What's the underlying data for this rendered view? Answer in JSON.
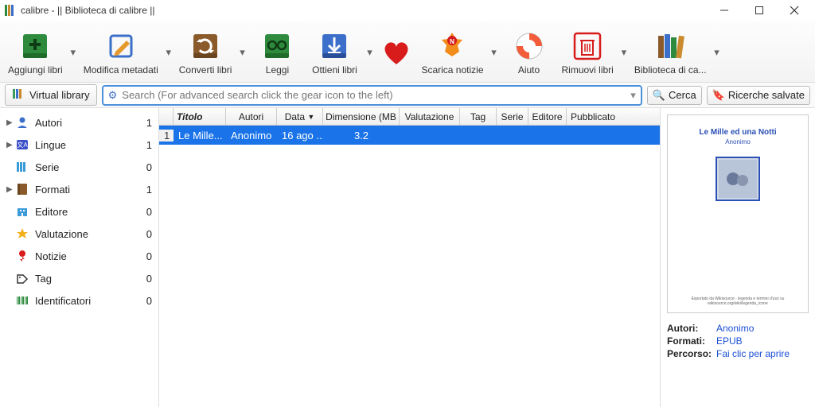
{
  "window": {
    "title": "calibre - || Biblioteca di calibre ||"
  },
  "toolbar": {
    "add": "Aggiungi libri",
    "edit": "Modifica metadati",
    "convert": "Converti libri",
    "read": "Leggi",
    "get": "Ottieni libri",
    "news": "Scarica notizie",
    "help": "Aiuto",
    "remove": "Rimuovi libri",
    "library": "Biblioteca di ca..."
  },
  "searchrow": {
    "virtual_library": "Virtual library",
    "placeholder": "Search (For advanced search click the gear icon to the left)",
    "search_btn": "Cerca",
    "saved_btn": "Ricerche salvate"
  },
  "sidebar": {
    "items": [
      {
        "label": "Autori",
        "count": "1",
        "expand": true
      },
      {
        "label": "Lingue",
        "count": "1",
        "expand": true
      },
      {
        "label": "Serie",
        "count": "0",
        "expand": false
      },
      {
        "label": "Formati",
        "count": "1",
        "expand": true
      },
      {
        "label": "Editore",
        "count": "0",
        "expand": false
      },
      {
        "label": "Valutazione",
        "count": "0",
        "expand": false
      },
      {
        "label": "Notizie",
        "count": "0",
        "expand": false
      },
      {
        "label": "Tag",
        "count": "0",
        "expand": false
      },
      {
        "label": "Identificatori",
        "count": "0",
        "expand": false
      }
    ]
  },
  "table": {
    "columns": [
      "Titolo",
      "Autori",
      "Data",
      "Dimensione (MB",
      "Valutazione",
      "Tag",
      "Serie",
      "Editore",
      "Pubblicato"
    ],
    "sort_arrow": "▼",
    "rows": [
      {
        "num": "1",
        "titolo": "Le Mille...",
        "autori": "Anonimo",
        "data": "16 ago ...",
        "dim": "3.2"
      }
    ]
  },
  "detail": {
    "cover_title": "Le Mille ed una Notti",
    "cover_sub": "Anonimo",
    "meta": {
      "autori_k": "Autori:",
      "autori_v": "Anonimo",
      "formati_k": "Formati:",
      "formati_v": "EPUB",
      "percorso_k": "Percorso:",
      "percorso_v": "Fai clic per aprire"
    }
  },
  "colors": {
    "accent": "#1a73e8",
    "toolbar_green": "#2e8b3d",
    "heart": "#d81b1b"
  }
}
